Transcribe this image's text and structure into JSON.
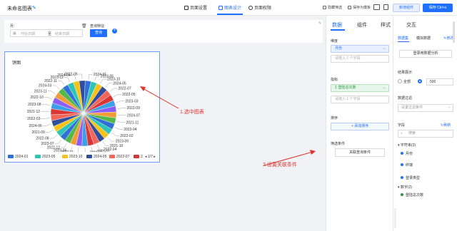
{
  "header": {
    "title": "未命名图表",
    "tabs": [
      {
        "label": "页面设置",
        "active": false
      },
      {
        "label": "图表设计",
        "active": true
      },
      {
        "label": "页面权限",
        "active": false
      }
    ],
    "tools": [
      "隐藏筛选",
      "保存为模板"
    ],
    "new_button": "新增组件",
    "save_button": "保存 Ctrl+s"
  },
  "filter": {
    "label_month": "月:",
    "label_query": "查询特征:",
    "start_placeholder": "开始日期",
    "to": "至",
    "end_placeholder": "结束日期",
    "query_button": "查询"
  },
  "chart": {
    "title": "饼图",
    "page_indicator": "1/7"
  },
  "chart_data": {
    "type": "pie",
    "title": "饼图",
    "categories": [
      "2024-01",
      "2023-05",
      "2023-10",
      "2024-05",
      "2022-07",
      "2022-05",
      "2023-03",
      "2022-09",
      "2024-07",
      "2021-11",
      "2023-04",
      "2022-02",
      "2023-09",
      "2021-10",
      "2022-04",
      "2023-01",
      "2024-02",
      "2022-01",
      "2023-06",
      "2022-12",
      "2023-07",
      "2022-08",
      "2021-09",
      "2024-06",
      "2022-03",
      "2021-12",
      "2023-08",
      "2022-10",
      "2023-11",
      "2024-03",
      "2022-11",
      "2023-12",
      "2024-04",
      "2022-06"
    ],
    "values": [
      3,
      3,
      3,
      3,
      3,
      3,
      3,
      3,
      3,
      3,
      3,
      3,
      3,
      3,
      3,
      3,
      3,
      3,
      3,
      3,
      3,
      3,
      3,
      3,
      3,
      3,
      3,
      3,
      3,
      3,
      3,
      3,
      3,
      3
    ],
    "colors": [
      "#2f6fd6",
      "#2ec4b6",
      "#f7c31a",
      "#2f4f9e",
      "#f4655a",
      "#d93636",
      "#3ba0e6",
      "#8b5cf6",
      "#f29c38",
      "#54b948"
    ],
    "legend": [
      "2024-01",
      "2023-05",
      "2023-10",
      "2024-05",
      "2022-07",
      "2"
    ],
    "legend_position": "bottom"
  },
  "annotations": {
    "a1": "1.选中图表",
    "a2": "2.设置关联条件"
  },
  "mid_panel": {
    "tabs": [
      {
        "label": "数据",
        "active": true
      },
      {
        "label": "组件",
        "active": false
      },
      {
        "label": "样式",
        "active": false
      }
    ],
    "dimension_label": "维度",
    "dimension_value": "月份",
    "dimension_placeholder": "请拖入 1 个字段",
    "metric_label": "指标",
    "metric_value": "Σ 登陆总次数",
    "metric_placeholder": "请拖入 1 个字段",
    "sort_label": "排序",
    "sort_button": "+ 添加排序",
    "filter_label": "筛选条件",
    "assoc_button": "关联查询条件"
  },
  "right_panel": {
    "tab": "交互",
    "sub_tabs": [
      "数据集",
      "模拟数据"
    ],
    "modify_label": "修改",
    "usage_button": "登录用数据分析",
    "result_label": "结果展示",
    "radio_all": "全部",
    "result_count": "500",
    "data_filter_label": "数据过滤",
    "data_filter_value": "设置过滤条件",
    "field_label": "字段",
    "refresh_label": "刷新",
    "search_placeholder": "搜索",
    "tree": {
      "string_group": "字符串(3)",
      "string_items": [
        "月份",
        "终端",
        "登录类型"
      ],
      "number_group": "数字(2)",
      "number_items": [
        "登陆总次数"
      ]
    }
  }
}
